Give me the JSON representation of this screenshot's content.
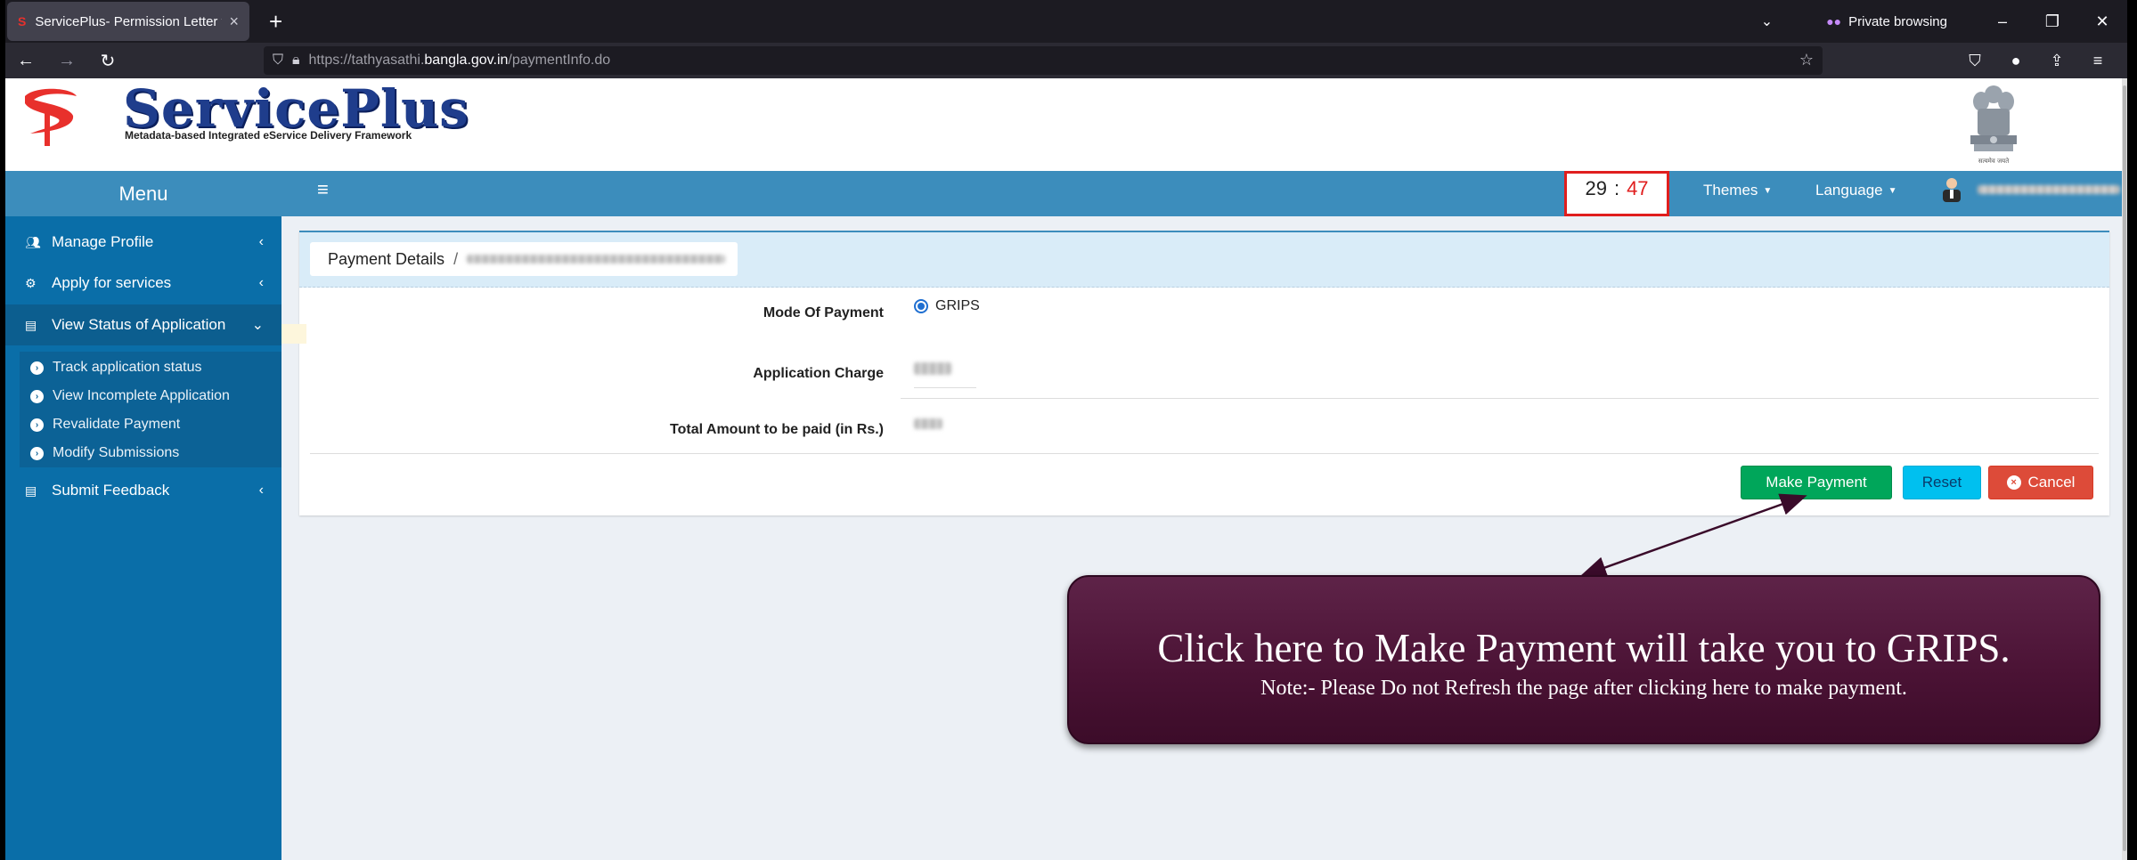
{
  "browser": {
    "tab_title": "ServicePlus- Permission Letter t",
    "tab_close": "×",
    "new_tab": "+",
    "private_label": "Private browsing",
    "url_prefix": "https://tathyasathi.",
    "url_domain": "bangla.gov.in",
    "url_path": "/paymentInfo.do"
  },
  "header": {
    "logo_title": "ServicePlus",
    "logo_subtitle": "Metadata-based Integrated eService Delivery Framework",
    "emblem_motto": "सत्यमेव जयते"
  },
  "topbar": {
    "menu_label": "Menu",
    "hamburger": "≡",
    "timer_minutes": "29",
    "timer_sep": ":",
    "timer_seconds": "47",
    "themes_label": "Themes",
    "language_label": "Language"
  },
  "sidebar": {
    "items": [
      {
        "label": "Manage Profile",
        "arrow": "‹"
      },
      {
        "label": "Apply for services",
        "arrow": "‹"
      },
      {
        "label": "View Status of Application",
        "arrow": "⌄"
      },
      {
        "label": "Submit Feedback",
        "arrow": "‹"
      }
    ],
    "sub_items": [
      {
        "label": "Track application status"
      },
      {
        "label": "View Incomplete Application"
      },
      {
        "label": "Revalidate Payment"
      },
      {
        "label": "Modify Submissions"
      }
    ]
  },
  "payment": {
    "breadcrumb_root": "Payment Details",
    "breadcrumb_sep": "/",
    "mode_label": "Mode Of Payment",
    "mode_value": "GRIPS",
    "charge_label": "Application Charge",
    "total_label": "Total Amount to be paid (in Rs.)"
  },
  "buttons": {
    "make_payment": "Make Payment",
    "reset": "Reset",
    "cancel": "Cancel"
  },
  "callout": {
    "title": "Click here to Make Payment will take you to GRIPS.",
    "note": "Note:- Please Do not Refresh the page after clicking here to make payment."
  },
  "colors": {
    "brand_blue": "#3c8dbc",
    "sidebar_blue": "#0a6ea8",
    "success_green": "#00a65a",
    "info_cyan": "#00c0ef",
    "danger_red": "#dd4b39",
    "callout_maroon": "#4a1234"
  }
}
